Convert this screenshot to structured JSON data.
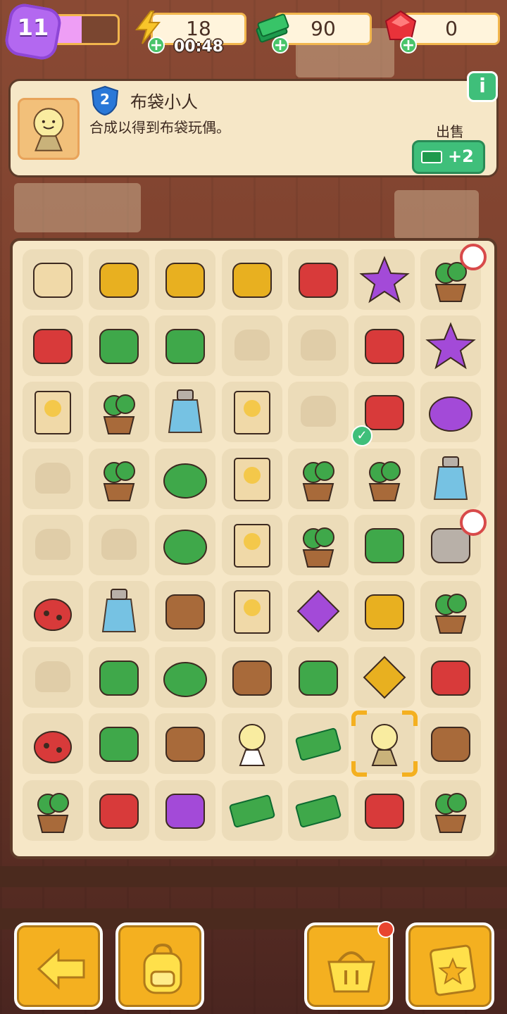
{
  "hud": {
    "level": "11",
    "level_progress": 0.5,
    "energy": {
      "value": "18",
      "timer": "00:48",
      "icon": "lightning-icon"
    },
    "cash": {
      "value": "90",
      "icon": "cash-stack-icon"
    },
    "gems": {
      "value": "0",
      "icon": "ruby-icon"
    }
  },
  "info": {
    "item_level": "2",
    "item_name": "布袋小人",
    "item_desc": "合成以得到布袋玩偶。",
    "sell_label": "出售",
    "sell_value": "+2"
  },
  "colors": {
    "accent_yellow": "#f4b020",
    "green": "#3fbf7a",
    "panel": "#f6e7c7",
    "border": "#5c3a28"
  },
  "board": {
    "columns": 7,
    "rows": 9,
    "cells": [
      [
        "ziplock-bag-icon",
        "sugar-cubes-icon",
        "brass-bell-icon",
        "brass-hook-icon",
        "red-pliers-icon",
        "purple-star-icon",
        "plant-pot-generator-icon"
      ],
      [
        "red-tray-icon",
        "red-toolbox-open-icon",
        "red-toolbox-chest-icon",
        "empty",
        "empty",
        "red-trowel-icon",
        "purple-star-face-icon"
      ],
      [
        "wanted-poster-icon",
        "broken-clay-pot-icon",
        "glass-vase-icon",
        "framed-photo-icon",
        "empty",
        "red-scissors-icon",
        "purple-blob-face-icon"
      ],
      [
        "empty",
        "potted-plant-icon",
        "green-sponge-icon",
        "photo-frame-icon",
        "sapling-pot-icon",
        "bonsai-pot-icon",
        "medicine-jar-icon"
      ],
      [
        "empty",
        "empty",
        "green-helmet-icon",
        "small-photo-icon",
        "seedling-pot-icon",
        "green-leaves-icon",
        "herb-mortar-generator-icon"
      ],
      [
        "ladybug-icon",
        "glass-jar-stand-icon",
        "clay-cup-icon",
        "photo-card-icon",
        "purple-gem-icon",
        "brass-dish-icon",
        "pottery-shard-icon"
      ],
      [
        "empty",
        "green-box-icon",
        "green-cloth-icon",
        "hammer-icon",
        "leaf-cookie-icon",
        "orange-gem-icon",
        "ruby-bag-icon"
      ],
      [
        "beetle-pair-icon",
        "green-box-icon",
        "stick-stand-icon",
        "lucky-cat-icon",
        "cash-bundle-icon",
        "sack-doll-icon",
        "magnifier-icon"
      ],
      [
        "potion-flask-icon",
        "red-chest-icon",
        "moth-icon",
        "cash-pile-icon",
        "cash-note-icon",
        "cookie-tray-icon",
        "flower-bush-icon"
      ]
    ],
    "selected_item": "sack-doll-icon",
    "check_item": "red-scissors-icon",
    "timer_items": [
      "plant-pot-generator-icon",
      "herb-mortar-generator-icon"
    ]
  },
  "nav": [
    {
      "icon": "back-arrow-icon"
    },
    {
      "icon": "backpack-icon"
    },
    {
      "icon": "shop-basket-icon",
      "notification": true
    },
    {
      "icon": "quest-clipboard-icon"
    }
  ]
}
